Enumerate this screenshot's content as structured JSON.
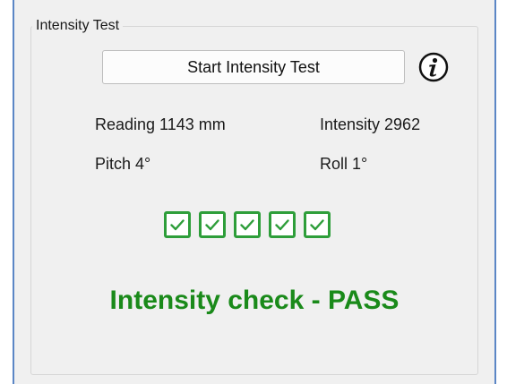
{
  "groupbox": {
    "title": "Intensity Test"
  },
  "start_button": {
    "label": "Start Intensity Test"
  },
  "info_icon": {
    "name": "info-icon"
  },
  "readings": {
    "reading": "Reading 1143 mm",
    "intensity": "Intensity 2962",
    "pitch": "Pitch 4°",
    "roll": "Roll 1°"
  },
  "checks": [
    {
      "checked": true
    },
    {
      "checked": true
    },
    {
      "checked": true
    },
    {
      "checked": true
    },
    {
      "checked": true
    }
  ],
  "status": {
    "text": "Intensity check - PASS",
    "color": "#1a8a1a"
  },
  "colors": {
    "check_border": "#2e9e3a",
    "window_border": "#5b86c5"
  }
}
